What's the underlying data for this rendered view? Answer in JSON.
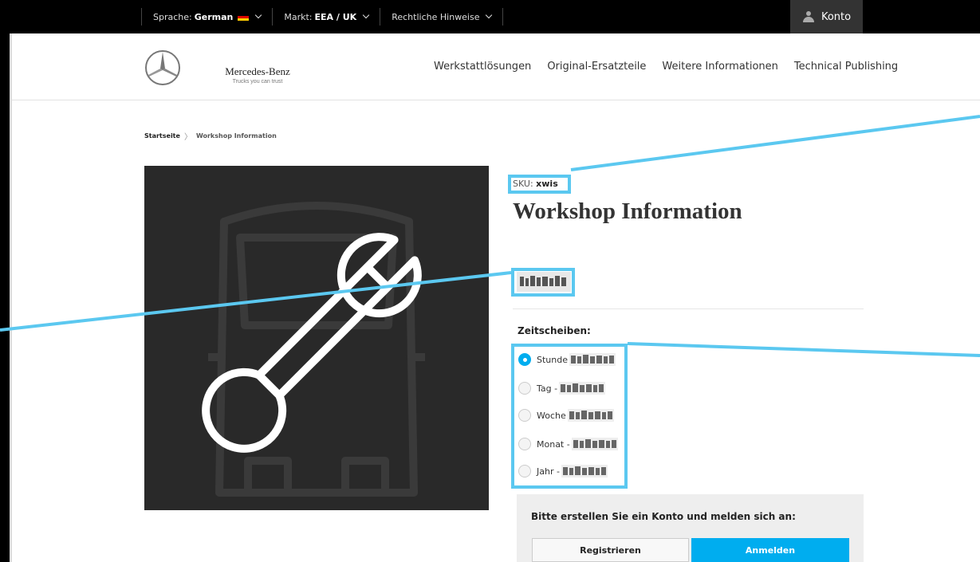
{
  "topbar": {
    "language_label": "Sprache:",
    "language_value": "German",
    "market_label": "Markt:",
    "market_value": "EEA / UK",
    "legal_label": "Rechtliche Hinweise",
    "account_label": "Konto"
  },
  "header": {
    "brand_name": "Mercedes-Benz",
    "brand_tagline": "Trucks you can trust",
    "nav": [
      {
        "label": "Werkstattlösungen"
      },
      {
        "label": "Original-Ersatzteile"
      },
      {
        "label": "Weitere Informationen"
      },
      {
        "label": "Technical Publishing"
      }
    ]
  },
  "breadcrumb": {
    "home": "Startseite",
    "current": "Workshop Information"
  },
  "product": {
    "sku_label": "SKU:",
    "sku_value": "xwis",
    "title": "Workshop Information",
    "image_icon": "wrench-icon"
  },
  "timeslices": {
    "label": "Zeitscheiben:",
    "options": [
      {
        "label": "Stunde",
        "selected": true
      },
      {
        "label": "Tag -",
        "selected": false
      },
      {
        "label": "Woche",
        "selected": false
      },
      {
        "label": "Monat -",
        "selected": false
      },
      {
        "label": "Jahr -",
        "selected": false
      }
    ]
  },
  "login": {
    "prompt": "Bitte erstellen Sie ein Konto und melden sich an:",
    "register_label": "Registrieren",
    "login_label": "Anmelden"
  },
  "colors": {
    "accent": "#00adef",
    "annotation": "#5bc8f0",
    "topbar": "#000000",
    "image_bg": "#292929"
  }
}
